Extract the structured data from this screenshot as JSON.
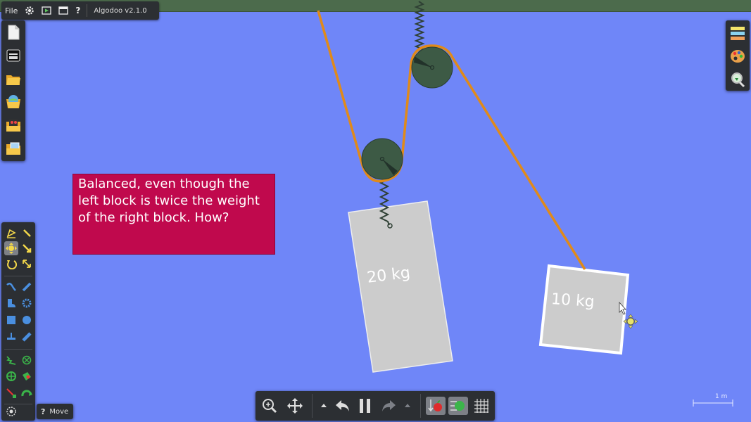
{
  "app": {
    "name": "Algodoo",
    "version": "Algodoo v2.1.0"
  },
  "menu": {
    "file_label": "File",
    "help_glyph": "?"
  },
  "left_toolbar": {
    "icons": [
      "new-scene-icon",
      "scene-window-icon",
      "open-folder-icon",
      "algobox-icon",
      "screenshot-folder-icon",
      "file-browser-icon"
    ]
  },
  "right_toolbar": {
    "icons": [
      "layers-icon",
      "color-palette-icon",
      "zoom-find-icon"
    ]
  },
  "tools": {
    "items": [
      "sketch-tool",
      "brush-tool",
      "move-tool",
      "drag-tool",
      "rotate-tool",
      "scale-tool",
      "rope-tool",
      "cutter-tool",
      "plane-tool",
      "gear-tool",
      "box-tool",
      "circle-tool",
      "fixate-tool",
      "pin-tool",
      "spring-tool",
      "hinge-tool",
      "thruster-tool",
      "tracer-tool",
      "laser-tool",
      "chain-tool",
      "fluid-tool"
    ],
    "selected": "move-tool"
  },
  "status": {
    "help_glyph": "?",
    "current_tool": "Move"
  },
  "bottom_toolbar": {
    "buttons": [
      "zoom-icon",
      "pan-icon",
      "undo-menu-icon",
      "undo-icon",
      "pause-icon",
      "redo-icon",
      "redo-menu-icon",
      "gravity-icon",
      "air-friction-icon",
      "grid-icon"
    ]
  },
  "scene": {
    "note_text": "Balanced, even though the left block is twice the weight of the right block. How?",
    "left_block_label": "20 kg",
    "right_block_label": "10 kg",
    "scale_label": "1 m"
  },
  "colors": {
    "background": "#6f86f8",
    "note": "#c0094d",
    "rope": "#e08a1a",
    "pulley": "#3d5a45",
    "block": "#cccccc",
    "panel": "#2c2f33"
  }
}
